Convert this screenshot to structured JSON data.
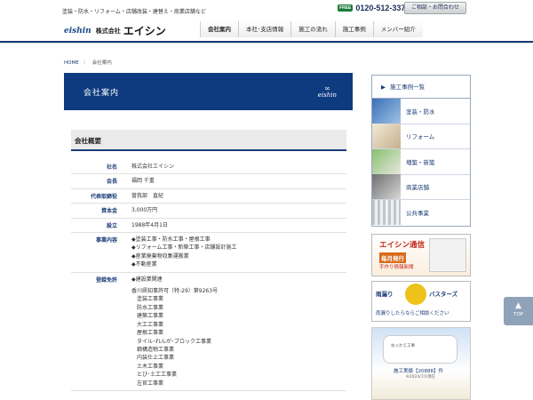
{
  "header": {
    "tagline": "塗装・防水・リフォーム・店舗改装・建替え・商業店舗など",
    "phone_badge": "FREE",
    "phone": "0120-512-337",
    "contact_label": "ご相談・お問合わせ",
    "logo_mark": "eishin",
    "logo_corp": "株式会社",
    "logo_name": "エイシン"
  },
  "nav": {
    "items": [
      {
        "label": "会社案内"
      },
      {
        "label": "本社･支店情報"
      },
      {
        "label": "施工の流れ"
      },
      {
        "label": "施工事例"
      },
      {
        "label": "メンバー紹介"
      }
    ]
  },
  "breadcrumb": {
    "home": "HOME",
    "current": "会社案内"
  },
  "banner": {
    "title": "会社案内",
    "logo": "eishin"
  },
  "section": {
    "title": "会社概要"
  },
  "company": {
    "rows": [
      {
        "label": "社名",
        "lines": [
          "株式会社エイシン"
        ]
      },
      {
        "label": "会長",
        "lines": [
          "福岡 千重"
        ]
      },
      {
        "label": "代表取締役",
        "lines": [
          "曽我部　直紀"
        ]
      },
      {
        "label": "資本金",
        "lines": [
          "3,000万円"
        ]
      },
      {
        "label": "設立",
        "lines": [
          "1988年4月1日"
        ]
      },
      {
        "label": "事業内容",
        "lines": [
          "◆塗装工事・防水工事・屋根工事",
          "◆リフォーム工事・新築工事・店舗設計施工",
          "◆産業廃棄物収集運搬業",
          "◆不動産業"
        ]
      },
      {
        "label": "登録免許",
        "lines": [
          "◆建設業関連",
          "",
          "香川県知事許可（特-29）第9263号",
          "　塗装工事業",
          "　防水工事業",
          "　建築工事業",
          "　大工工事業",
          "　屋根工事業",
          "　タイル･れんが･ブロック工事業",
          "　鋼構造物工事業",
          "　内装仕上工事業",
          "　土木工事業",
          "　とび･土工工事業",
          "　左官工事業"
        ]
      }
    ]
  },
  "sidebar": {
    "heading": "施工事例一覧",
    "items": [
      {
        "label": "塗装・防水"
      },
      {
        "label": "リフォーム"
      },
      {
        "label": "増築・新築"
      },
      {
        "label": "商業店舗"
      },
      {
        "label": "公共事業"
      }
    ]
  },
  "banners": {
    "tsushin_title": "エイシン通信",
    "tsushin_sub": "毎月発行",
    "tsushin_note": "手作り情報新聞",
    "amamori_title": "雨漏り",
    "amamori_brand": "バスターズ",
    "amamori_note": "雨漏りしたらならご相談ください",
    "record_badge": "ねっかえ工事",
    "record_text": "施工実績【20888】件",
    "record_date": "※2024/7/1現在"
  },
  "pagetop": {
    "label": "TOP"
  },
  "colors": {
    "brand_navy": "#0e3b80",
    "label_navy": "#1a3b75"
  }
}
